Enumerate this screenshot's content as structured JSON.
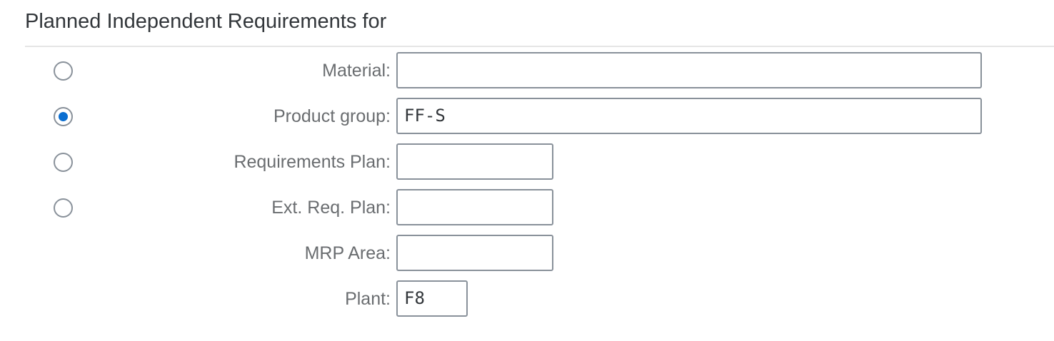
{
  "section": {
    "title": "Planned Independent Requirements for"
  },
  "rows": [
    {
      "label": "Material:",
      "value": "",
      "radio": "unselected"
    },
    {
      "label": "Product group:",
      "value": "FF-S",
      "radio": "selected"
    },
    {
      "label": "Requirements Plan:",
      "value": "",
      "radio": "unselected"
    },
    {
      "label": "Ext. Req. Plan:",
      "value": "",
      "radio": "unselected"
    },
    {
      "label": "MRP Area:",
      "value": ""
    },
    {
      "label": "Plant:",
      "value": "F8"
    }
  ],
  "colors": {
    "accent": "#0a6ed1",
    "label_text": "#6a6d70",
    "field_border": "#89919a"
  }
}
